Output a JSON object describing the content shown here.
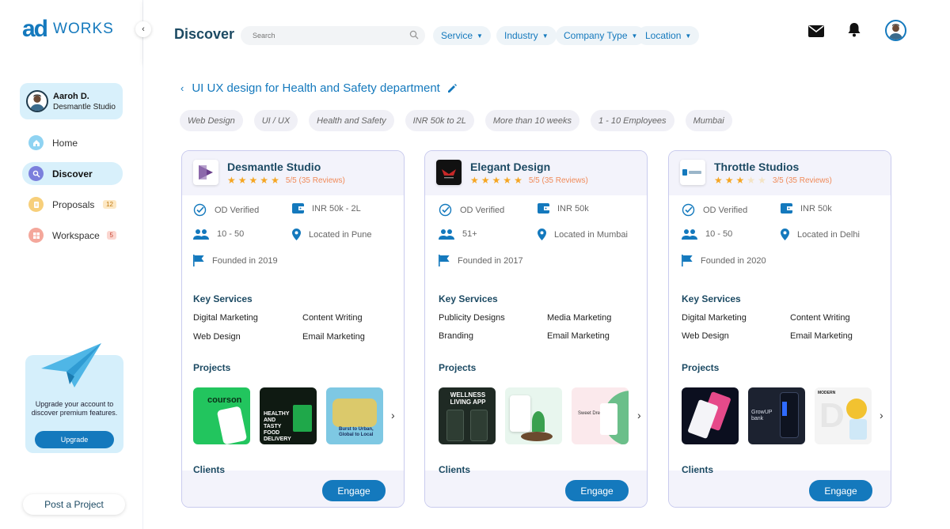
{
  "brand": {
    "mark": "ad",
    "word": "WORKS"
  },
  "user": {
    "name": "Aaroh D.",
    "org": "Desmantle Studio"
  },
  "nav": [
    {
      "label": "Home",
      "icon": "home-icon",
      "color": "#6ec6ef"
    },
    {
      "label": "Discover",
      "icon": "search-icon",
      "color": "#6b6fd6"
    },
    {
      "label": "Proposals",
      "icon": "proposals-icon",
      "color": "#f5c66a",
      "badge": "12"
    },
    {
      "label": "Workspace",
      "icon": "workspace-icon",
      "color": "#f29b8e",
      "badge": "5"
    }
  ],
  "upgrade": {
    "text": "Upgrade your account to discover premium features.",
    "button": "Upgrade"
  },
  "post_project": "Post a Project",
  "header": {
    "title": "Discover",
    "search_placeholder": "Search",
    "filters": [
      "Service",
      "Industry",
      "Company Type",
      "Location"
    ]
  },
  "project": {
    "title": "UI UX design for Health and Safety department",
    "tags": [
      "Web Design",
      "UI / UX",
      "Health and Safety",
      "INR 50k to 2L",
      "More than 10 weeks",
      "1 - 10 Employees",
      "Mumbai"
    ]
  },
  "labels": {
    "key_services": "Key Services",
    "projects": "Projects",
    "clients": "Clients",
    "engage": "Engage"
  },
  "cards": [
    {
      "name": "Desmantle Studio",
      "rating_stars": 5,
      "rating_text": "5/5 (35 Reviews)",
      "verified": "OD Verified",
      "budget": "INR 50k - 2L",
      "size": "10 - 50",
      "location": "Located in Pune",
      "founded": "Founded in 2019",
      "services": [
        "Digital Marketing",
        "Content Writing",
        "Web Design",
        "Email Marketing"
      ],
      "thumbs": [
        {
          "text": "courson",
          "bg": "#22c55e",
          "fg": "#0b2e17"
        },
        {
          "text": "HEALTHY AND TASTY FOOD DELIVERY",
          "bg": "#0f1a12",
          "fg": "#ffffff"
        },
        {
          "text": "Burst to Urban, Global to Local",
          "bg": "#7ec8e3",
          "fg": "#1b2b5a"
        }
      ]
    },
    {
      "name": "Elegant Design",
      "rating_stars": 5,
      "rating_text": "5/5 (35 Reviews)",
      "verified": "OD Verified",
      "budget": "INR 50k",
      "size": "51+",
      "location": "Located in Mumbai",
      "founded": "Founded in 2017",
      "services": [
        "Publicity Designs",
        "Media Marketing",
        "Branding",
        "Email Marketing"
      ],
      "thumbs": [
        {
          "text": "WELLNESS LIVING APP",
          "bg": "#1f2a24",
          "fg": "#ffffff"
        },
        {
          "text": "",
          "bg": "#e8f6ee",
          "fg": "#2a7a3a"
        },
        {
          "text": "Sweet Dreams",
          "bg": "#fbe9ec",
          "fg": "#333333"
        }
      ]
    },
    {
      "name": "Throttle Studios",
      "rating_stars": 3,
      "rating_text": "3/5 (35 Reviews)",
      "verified": "OD Verified",
      "budget": "INR 50k",
      "size": "10 - 50",
      "location": "Located in Delhi",
      "founded": "Founded in 2020",
      "services": [
        "Digital Marketing",
        "Content Writing",
        "Web Design",
        "Email Marketing"
      ],
      "thumbs": [
        {
          "text": "",
          "bg": "#0b0f1f",
          "fg": "#ffffff"
        },
        {
          "text": "GrowUP bank",
          "bg": "#1c2230",
          "fg": "#d8dde8"
        },
        {
          "text": "MODERN",
          "bg": "#f4f4f4",
          "fg": "#222222"
        }
      ]
    }
  ],
  "colors": {
    "accent": "#1479bd",
    "title": "#1c4a63",
    "star": "#f5a623",
    "card_border": "#c9cbee"
  }
}
